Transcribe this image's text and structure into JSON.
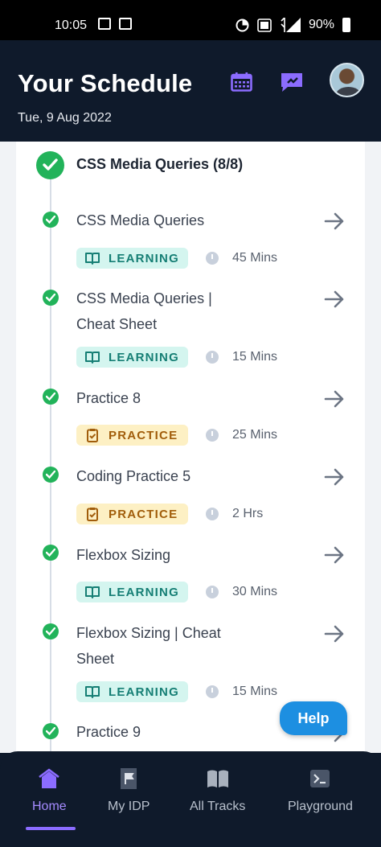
{
  "status_bar": {
    "time": "10:05",
    "battery": "90%"
  },
  "header": {
    "title": "Your Schedule",
    "date": "Tue, 9 Aug 2022"
  },
  "section": {
    "title": "CSS Media Queries (8/8)"
  },
  "items": [
    {
      "name": "CSS Media Queries",
      "type": "LEARNING",
      "duration": "45 Mins"
    },
    {
      "name": "CSS Media Queries | Cheat Sheet",
      "type": "LEARNING",
      "duration": "15 Mins"
    },
    {
      "name": "Practice 8",
      "type": "PRACTICE",
      "duration": "25 Mins"
    },
    {
      "name": "Coding Practice 5",
      "type": "PRACTICE",
      "duration": "2 Hrs"
    },
    {
      "name": "Flexbox Sizing",
      "type": "LEARNING",
      "duration": "30 Mins"
    },
    {
      "name": "Flexbox Sizing | Cheat Sheet",
      "type": "LEARNING",
      "duration": "15 Mins"
    },
    {
      "name": "Practice 9",
      "type": "",
      "duration": ""
    }
  ],
  "help": {
    "label": "Help"
  },
  "nav": [
    {
      "label": "Home",
      "icon": "home-icon",
      "active": true
    },
    {
      "label": "My IDP",
      "icon": "flag-document-icon",
      "active": false
    },
    {
      "label": "All Tracks",
      "icon": "open-book-icon",
      "active": false
    },
    {
      "label": "Playground",
      "icon": "terminal-icon",
      "active": false
    }
  ],
  "colors": {
    "accent": "#8b6cff",
    "success": "#22b35a",
    "learning_bg": "#d4f5ef",
    "practice_bg": "#fdf0c4",
    "help": "#1d8fe1"
  }
}
